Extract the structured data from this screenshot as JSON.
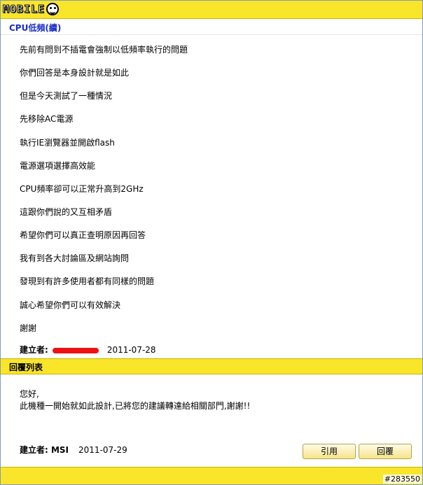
{
  "header": {
    "logo_text": "MOBILE"
  },
  "post": {
    "title": "CPU低頻(續)",
    "lines": [
      "先前有問到不插電會強制以低頻率執行的問題",
      "你們回答是本身設計就是如此",
      "但是今天測試了一種情況",
      "先移除AC電源",
      "執行IE瀏覽器並開啟flash",
      "電源選項選擇高效能",
      "CPU頻率卻可以正常升高到2GHz",
      "這跟你們說的又互相矛盾",
      "希望你們可以真正查明原因再回答",
      "我有到各大討論區及網站詢問",
      "發現到有許多使用者都有同樣的問題",
      "誠心希望你們可以有效解決",
      "謝謝"
    ],
    "meta": {
      "label": "建立者:",
      "date": "2011-07-28"
    }
  },
  "reply_section": {
    "title": "回覆列表",
    "reply": {
      "lines": [
        "您好,",
        "此機種一開始就如此設計,已將您的建議轉達給相關部門,謝謝!!"
      ],
      "meta": {
        "label": "建立者: MSI",
        "date": "2011-07-29"
      },
      "buttons": {
        "quote": "引用",
        "reply": "回覆"
      }
    }
  },
  "watermark": "#283550",
  "colors": {
    "bar": "#f9e52a",
    "title_blue": "#1a2ec8",
    "redaction": "#e11111"
  }
}
